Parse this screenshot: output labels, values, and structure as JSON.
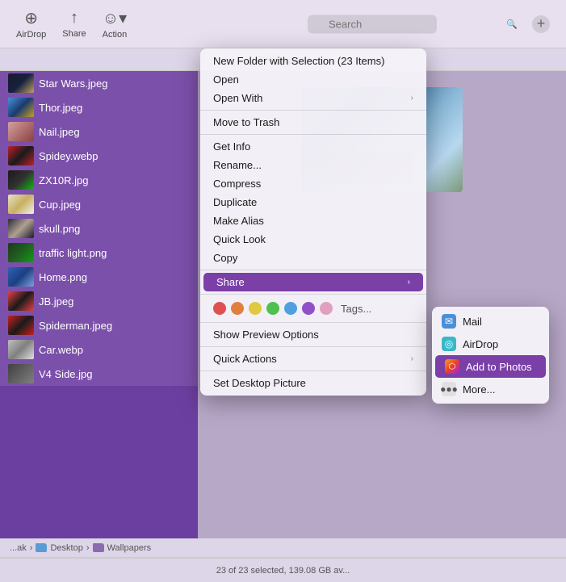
{
  "toolbar": {
    "airdrop_label": "AirDrop",
    "share_label": "Share",
    "action_label": "Action",
    "search_placeholder": "Search",
    "add_button_label": "+"
  },
  "folder_title": "Wallpapers",
  "breadcrumb": {
    "items": [
      "...ak",
      "Desktop",
      "Wallpapers"
    ]
  },
  "file_list": {
    "items": [
      {
        "name": "Star Wars.jpeg",
        "thumb_class": "thumb-star-wars"
      },
      {
        "name": "Thor.jpeg",
        "thumb_class": "thumb-thor"
      },
      {
        "name": "Nail.jpeg",
        "thumb_class": "thumb-nail"
      },
      {
        "name": "Spidey.webp",
        "thumb_class": "thumb-spidey"
      },
      {
        "name": "ZX10R.jpg",
        "thumb_class": "thumb-zx10r"
      },
      {
        "name": "Cup.jpeg",
        "thumb_class": "thumb-cup"
      },
      {
        "name": "skull.png",
        "thumb_class": "thumb-skull"
      },
      {
        "name": "traffic light.png",
        "thumb_class": "thumb-traffic"
      },
      {
        "name": "Home.png",
        "thumb_class": "thumb-home"
      },
      {
        "name": "JB.jpeg",
        "thumb_class": "thumb-jb"
      },
      {
        "name": "Spiderman.jpeg",
        "thumb_class": "thumb-spiderman"
      },
      {
        "name": "Car.webp",
        "thumb_class": "thumb-car"
      },
      {
        "name": "V4 Side.jpg",
        "thumb_class": "thumb-v4"
      }
    ]
  },
  "status_bar": {
    "text": "23 of 23 selected, 139.08 GB av..."
  },
  "context_menu": {
    "items": [
      {
        "id": "new-folder",
        "label": "New Folder with Selection (23 Items)",
        "disabled": false,
        "has_submenu": false
      },
      {
        "id": "open",
        "label": "Open",
        "disabled": false,
        "has_submenu": false
      },
      {
        "id": "open-with",
        "label": "Open With",
        "disabled": false,
        "has_submenu": true
      },
      {
        "id": "divider1"
      },
      {
        "id": "move-trash",
        "label": "Move to Trash",
        "disabled": false,
        "has_submenu": false
      },
      {
        "id": "divider2"
      },
      {
        "id": "get-info",
        "label": "Get Info",
        "disabled": false,
        "has_submenu": false
      },
      {
        "id": "rename",
        "label": "Rename...",
        "disabled": false,
        "has_submenu": false
      },
      {
        "id": "compress",
        "label": "Compress",
        "disabled": false,
        "has_submenu": false
      },
      {
        "id": "duplicate",
        "label": "Duplicate",
        "disabled": false,
        "has_submenu": false
      },
      {
        "id": "make-alias",
        "label": "Make Alias",
        "disabled": false,
        "has_submenu": false
      },
      {
        "id": "quick-look",
        "label": "Quick Look",
        "disabled": false,
        "has_submenu": false
      },
      {
        "id": "copy",
        "label": "Copy",
        "disabled": false,
        "has_submenu": false
      },
      {
        "id": "divider3"
      },
      {
        "id": "share",
        "label": "Share",
        "disabled": false,
        "has_submenu": true,
        "active": true
      },
      {
        "id": "divider4"
      },
      {
        "id": "tags-label",
        "type": "tags"
      },
      {
        "id": "divider5"
      },
      {
        "id": "show-preview",
        "label": "Show Preview Options",
        "disabled": false,
        "has_submenu": false
      },
      {
        "id": "divider6"
      },
      {
        "id": "quick-actions",
        "label": "Quick Actions",
        "disabled": false,
        "has_submenu": true
      },
      {
        "id": "divider7"
      },
      {
        "id": "set-desktop",
        "label": "Set Desktop Picture",
        "disabled": false,
        "has_submenu": false
      }
    ],
    "tags": {
      "colors": [
        "#e05050",
        "#e08040",
        "#e0c840",
        "#50c050",
        "#50a0e0",
        "#9050c8",
        "#e0a0c0"
      ]
    }
  },
  "share_submenu": {
    "items": [
      {
        "id": "mail",
        "label": "Mail",
        "icon_type": "mail"
      },
      {
        "id": "airdrop",
        "label": "AirDrop",
        "icon_type": "airdrop"
      },
      {
        "id": "add-photos",
        "label": "Add to Photos",
        "icon_type": "photos",
        "highlighted": true
      },
      {
        "id": "more",
        "label": "More...",
        "icon_type": "more"
      }
    ]
  }
}
